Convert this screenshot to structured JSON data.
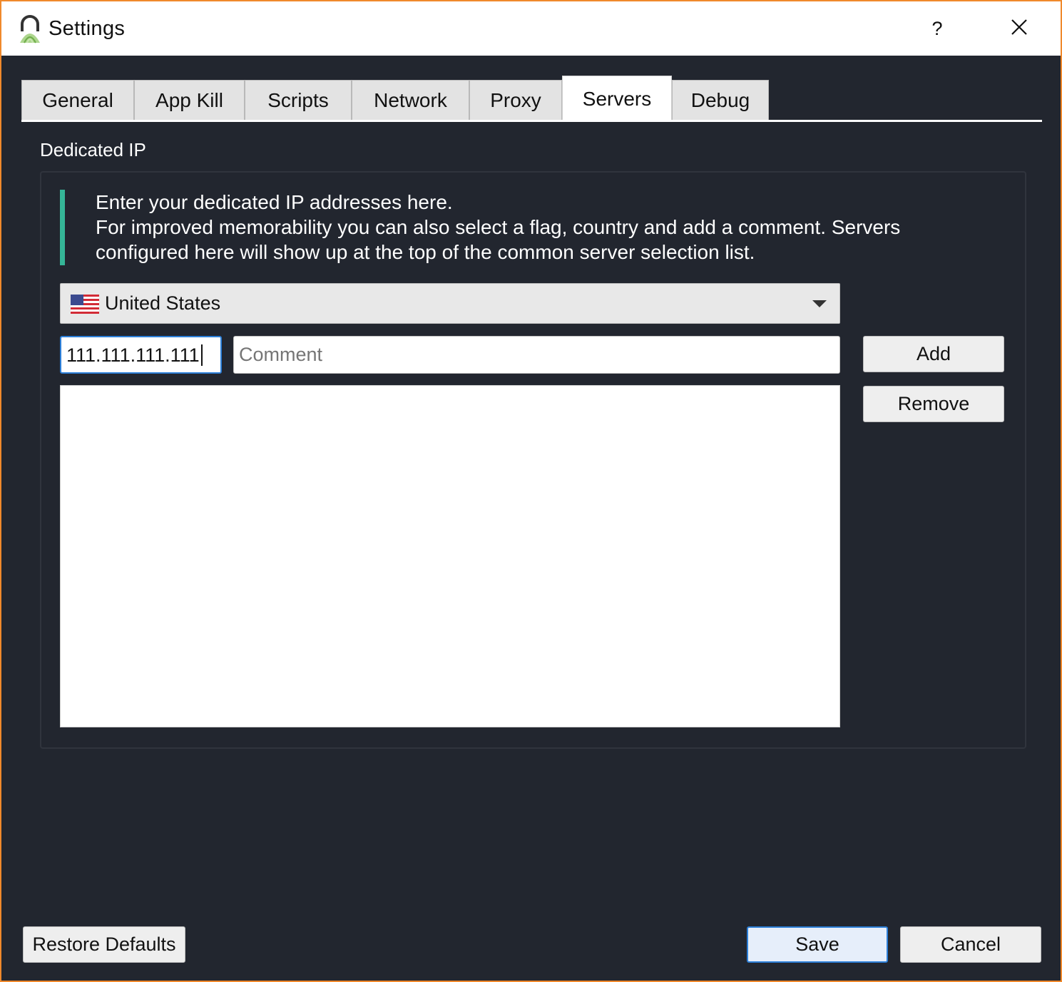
{
  "window": {
    "title": "Settings",
    "help_label": "?",
    "icons": {
      "app": "pia-lock-icon",
      "close": "close-icon"
    }
  },
  "tabs": [
    {
      "label": "General",
      "active": false
    },
    {
      "label": "App Kill",
      "active": false
    },
    {
      "label": "Scripts",
      "active": false
    },
    {
      "label": "Network",
      "active": false
    },
    {
      "label": "Proxy",
      "active": false
    },
    {
      "label": "Servers",
      "active": true
    },
    {
      "label": "Debug",
      "active": false
    }
  ],
  "section": {
    "title": "Dedicated IP",
    "info_lines": [
      "Enter your dedicated IP addresses here.",
      "For improved memorability you can also select a flag, country and add a comment. Servers",
      "configured here will show up at the top of the common server selection list."
    ],
    "country_select": {
      "value": "United States",
      "flag_icon": "us-flag-icon"
    },
    "ip_input": {
      "value": "111.111.111.111"
    },
    "comment_input": {
      "placeholder": "Comment",
      "value": ""
    },
    "add_label": "Add",
    "remove_label": "Remove",
    "server_list": []
  },
  "footer": {
    "restore_label": "Restore Defaults",
    "save_label": "Save",
    "cancel_label": "Cancel"
  },
  "colors": {
    "background": "#22262f",
    "accent": "#35b597",
    "focus": "#2c7fd8",
    "window_border": "#f0892b"
  }
}
